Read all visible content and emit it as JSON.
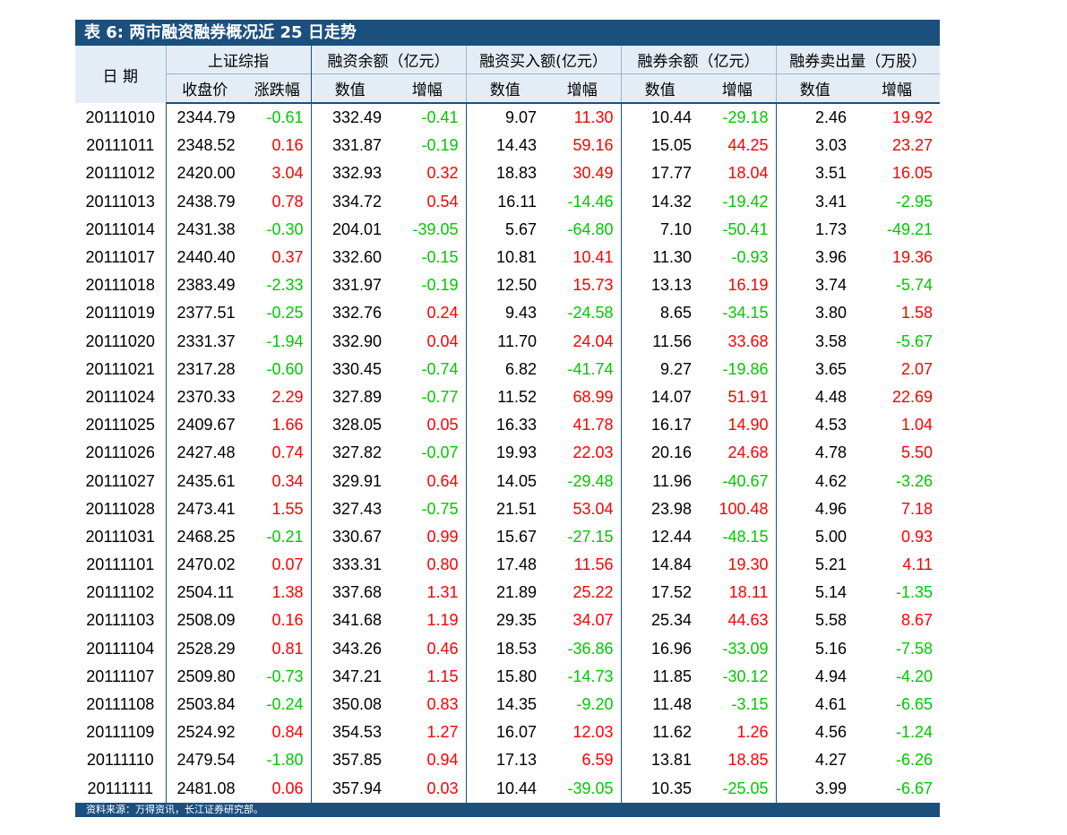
{
  "title": "表 6:  两市融资融券概况近 25 日走势",
  "header": {
    "date_label": "日 期",
    "groups": [
      "上证综指",
      "融资余额（亿元）",
      "融资买入额(亿元）",
      "融券余额（亿元）",
      "融券卖出量（万股）"
    ],
    "sub_labels": [
      "收盘价",
      "涨跌幅",
      "数值",
      "增幅",
      "数值",
      "增幅",
      "数值",
      "增幅",
      "数值",
      "增幅"
    ]
  },
  "rows": [
    [
      "20111010",
      "2344.79",
      "-0.61",
      "332.49",
      "-0.41",
      "9.07",
      "11.30",
      "10.44",
      "-29.18",
      "2.46",
      "19.92"
    ],
    [
      "20111011",
      "2348.52",
      "0.16",
      "331.87",
      "-0.19",
      "14.43",
      "59.16",
      "15.05",
      "44.25",
      "3.03",
      "23.27"
    ],
    [
      "20111012",
      "2420.00",
      "3.04",
      "332.93",
      "0.32",
      "18.83",
      "30.49",
      "17.77",
      "18.04",
      "3.51",
      "16.05"
    ],
    [
      "20111013",
      "2438.79",
      "0.78",
      "334.72",
      "0.54",
      "16.11",
      "-14.46",
      "14.32",
      "-19.42",
      "3.41",
      "-2.95"
    ],
    [
      "20111014",
      "2431.38",
      "-0.30",
      "204.01",
      "-39.05",
      "5.67",
      "-64.80",
      "7.10",
      "-50.41",
      "1.73",
      "-49.21"
    ],
    [
      "20111017",
      "2440.40",
      "0.37",
      "332.60",
      "-0.15",
      "10.81",
      "10.41",
      "11.30",
      "-0.93",
      "3.96",
      "19.36"
    ],
    [
      "20111018",
      "2383.49",
      "-2.33",
      "331.97",
      "-0.19",
      "12.50",
      "15.73",
      "13.13",
      "16.19",
      "3.74",
      "-5.74"
    ],
    [
      "20111019",
      "2377.51",
      "-0.25",
      "332.76",
      "0.24",
      "9.43",
      "-24.58",
      "8.65",
      "-34.15",
      "3.80",
      "1.58"
    ],
    [
      "20111020",
      "2331.37",
      "-1.94",
      "332.90",
      "0.04",
      "11.70",
      "24.04",
      "11.56",
      "33.68",
      "3.58",
      "-5.67"
    ],
    [
      "20111021",
      "2317.28",
      "-0.60",
      "330.45",
      "-0.74",
      "6.82",
      "-41.74",
      "9.27",
      "-19.86",
      "3.65",
      "2.07"
    ],
    [
      "20111024",
      "2370.33",
      "2.29",
      "327.89",
      "-0.77",
      "11.52",
      "68.99",
      "14.07",
      "51.91",
      "4.48",
      "22.69"
    ],
    [
      "20111025",
      "2409.67",
      "1.66",
      "328.05",
      "0.05",
      "16.33",
      "41.78",
      "16.17",
      "14.90",
      "4.53",
      "1.04"
    ],
    [
      "20111026",
      "2427.48",
      "0.74",
      "327.82",
      "-0.07",
      "19.93",
      "22.03",
      "20.16",
      "24.68",
      "4.78",
      "5.50"
    ],
    [
      "20111027",
      "2435.61",
      "0.34",
      "329.91",
      "0.64",
      "14.05",
      "-29.48",
      "11.96",
      "-40.67",
      "4.62",
      "-3.26"
    ],
    [
      "20111028",
      "2473.41",
      "1.55",
      "327.43",
      "-0.75",
      "21.51",
      "53.04",
      "23.98",
      "100.48",
      "4.96",
      "7.18"
    ],
    [
      "20111031",
      "2468.25",
      "-0.21",
      "330.67",
      "0.99",
      "15.67",
      "-27.15",
      "12.44",
      "-48.15",
      "5.00",
      "0.93"
    ],
    [
      "20111101",
      "2470.02",
      "0.07",
      "333.31",
      "0.80",
      "17.48",
      "11.56",
      "14.84",
      "19.30",
      "5.21",
      "4.11"
    ],
    [
      "20111102",
      "2504.11",
      "1.38",
      "337.68",
      "1.31",
      "21.89",
      "25.22",
      "17.52",
      "18.11",
      "5.14",
      "-1.35"
    ],
    [
      "20111103",
      "2508.09",
      "0.16",
      "341.68",
      "1.19",
      "29.35",
      "34.07",
      "25.34",
      "44.63",
      "5.58",
      "8.67"
    ],
    [
      "20111104",
      "2528.29",
      "0.81",
      "343.26",
      "0.46",
      "18.53",
      "-36.86",
      "16.96",
      "-33.09",
      "5.16",
      "-7.58"
    ],
    [
      "20111107",
      "2509.80",
      "-0.73",
      "347.21",
      "1.15",
      "15.80",
      "-14.73",
      "11.85",
      "-30.12",
      "4.94",
      "-4.20"
    ],
    [
      "20111108",
      "2503.84",
      "-0.24",
      "350.08",
      "0.83",
      "14.35",
      "-9.20",
      "11.48",
      "-3.15",
      "4.61",
      "-6.65"
    ],
    [
      "20111109",
      "2524.92",
      "0.84",
      "354.53",
      "1.27",
      "16.07",
      "12.03",
      "11.62",
      "1.26",
      "4.56",
      "-1.24"
    ],
    [
      "20111110",
      "2479.54",
      "-1.80",
      "357.85",
      "0.94",
      "17.13",
      "6.59",
      "13.81",
      "18.85",
      "4.27",
      "-6.26"
    ],
    [
      "20111111",
      "2481.08",
      "0.06",
      "357.94",
      "0.03",
      "10.44",
      "-39.05",
      "10.35",
      "-25.05",
      "3.99",
      "-6.67"
    ]
  ],
  "footer": "资料来源：万得资讯，长江证券研究部。",
  "colors": {
    "header_bar": "#1b4f7e",
    "header_bg": "#e4edf6",
    "positive": "#ff0000",
    "negative": "#00c800"
  }
}
